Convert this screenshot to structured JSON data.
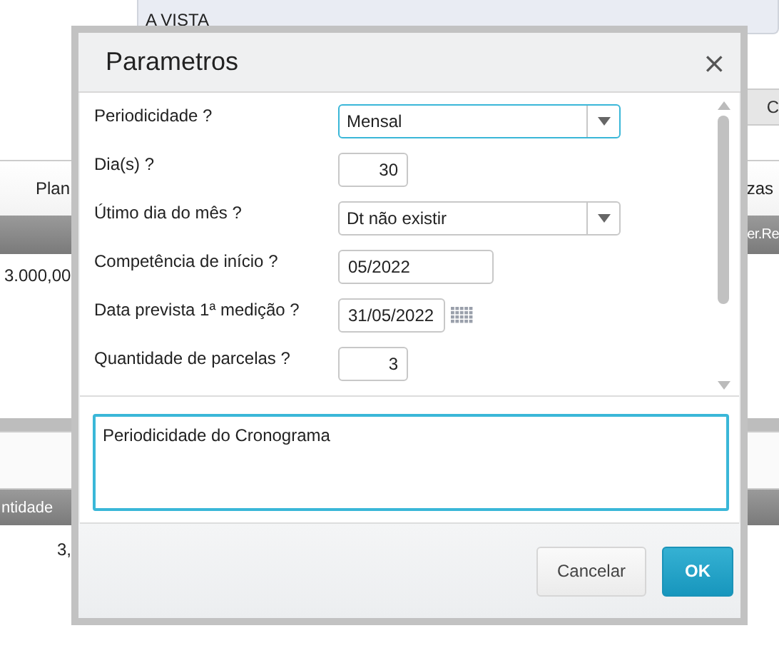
{
  "background": {
    "payment_condition": "A VISTA",
    "side_button": "C",
    "column_1": "Plan",
    "column_2": "zas",
    "header_column": "er.Re",
    "value": "3.000,00",
    "header_column_2": "ntidade",
    "value_2": "3,"
  },
  "dialog": {
    "title": "Parametros",
    "close": "×",
    "fields": [
      {
        "kind": "select",
        "label": "Periodicidade ?",
        "value": "Mensal",
        "focused": true
      },
      {
        "kind": "number",
        "label": "Dia(s) ?",
        "value": "30",
        "focused": false
      },
      {
        "kind": "select",
        "label": "Útimo dia do mês ?",
        "value": "Dt não existir",
        "focused": false
      },
      {
        "kind": "text",
        "label": "Competência de início ?",
        "value": "05/2022",
        "focused": false
      },
      {
        "kind": "date",
        "label": "Data prevista 1ª medição ?",
        "value": "31/05/2022",
        "focused": false
      },
      {
        "kind": "number",
        "label": "Quantidade de parcelas ?",
        "value": "3",
        "focused": false
      }
    ],
    "help_text": "Periodicidade do Cronograma",
    "buttons": [
      {
        "kind": "secondary",
        "label": "Cancelar"
      },
      {
        "kind": "primary",
        "label": "OK"
      }
    ]
  }
}
